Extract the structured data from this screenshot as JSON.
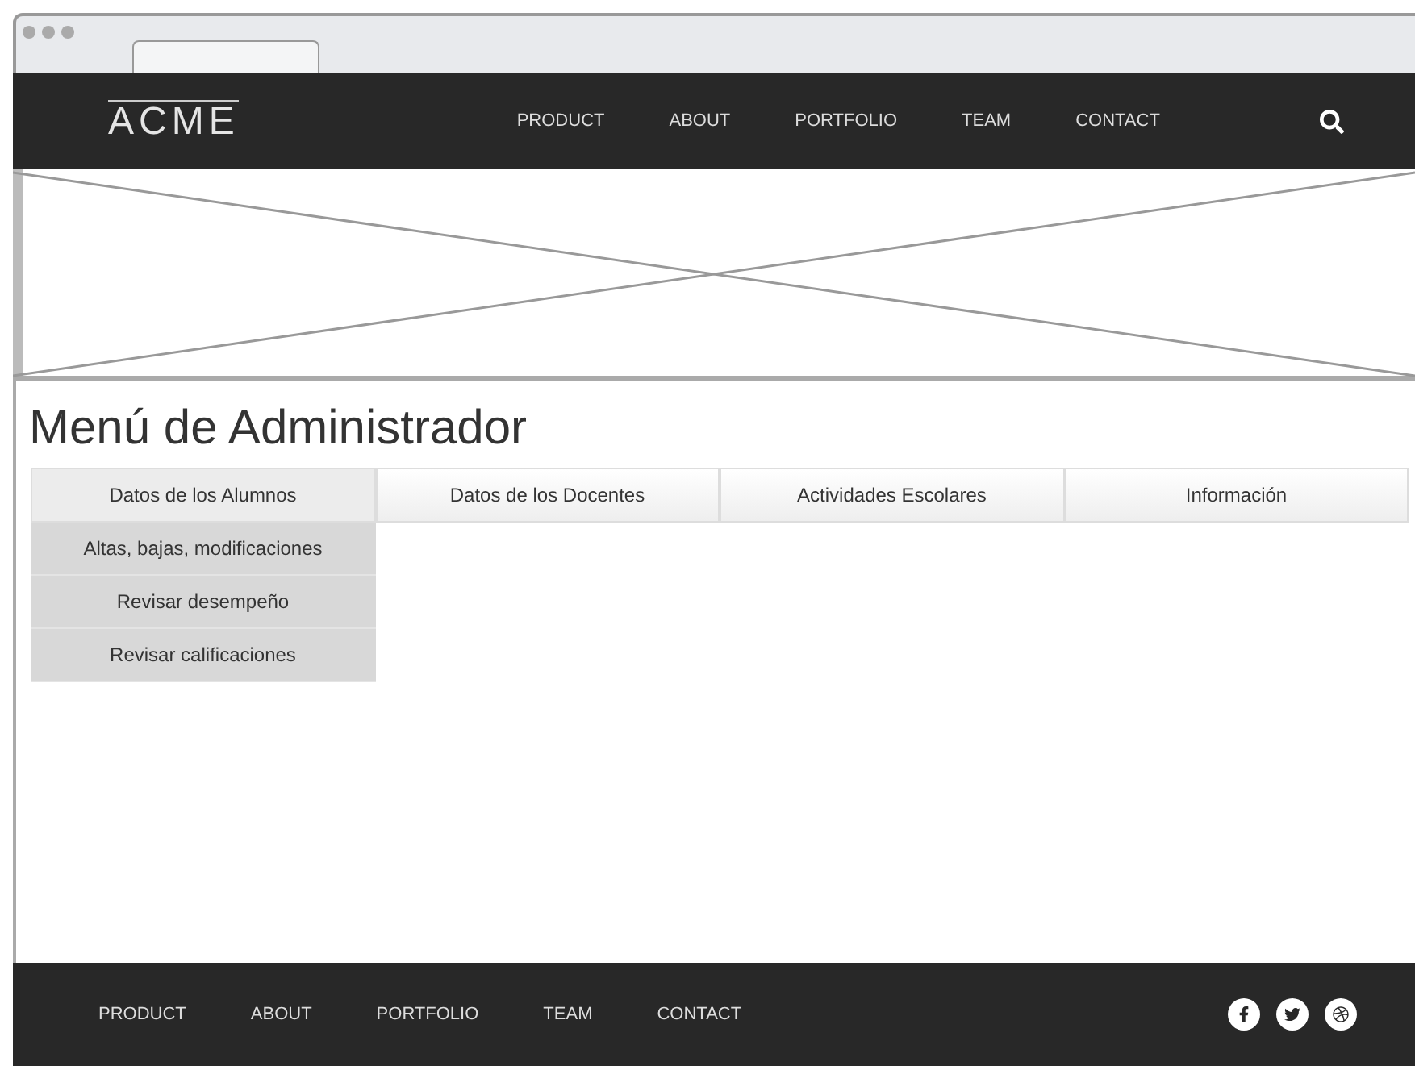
{
  "header": {
    "logo": "ACME",
    "nav": [
      "PRODUCT",
      "ABOUT",
      "PORTFOLIO",
      "TEAM",
      "CONTACT"
    ]
  },
  "title": "Menú de Administrador",
  "menu": [
    {
      "label": "Datos de los Alumnos",
      "expanded": true,
      "children": [
        "Altas, bajas, modificaciones",
        "Revisar desempeño",
        "Revisar calificaciones"
      ]
    },
    {
      "label": "Datos de los Docentes",
      "expanded": false
    },
    {
      "label": "Actividades Escolares",
      "expanded": false
    },
    {
      "label": "Información",
      "expanded": false
    }
  ],
  "footer": {
    "nav": [
      "PRODUCT",
      "ABOUT",
      "PORTFOLIO",
      "TEAM",
      "CONTACT"
    ]
  }
}
